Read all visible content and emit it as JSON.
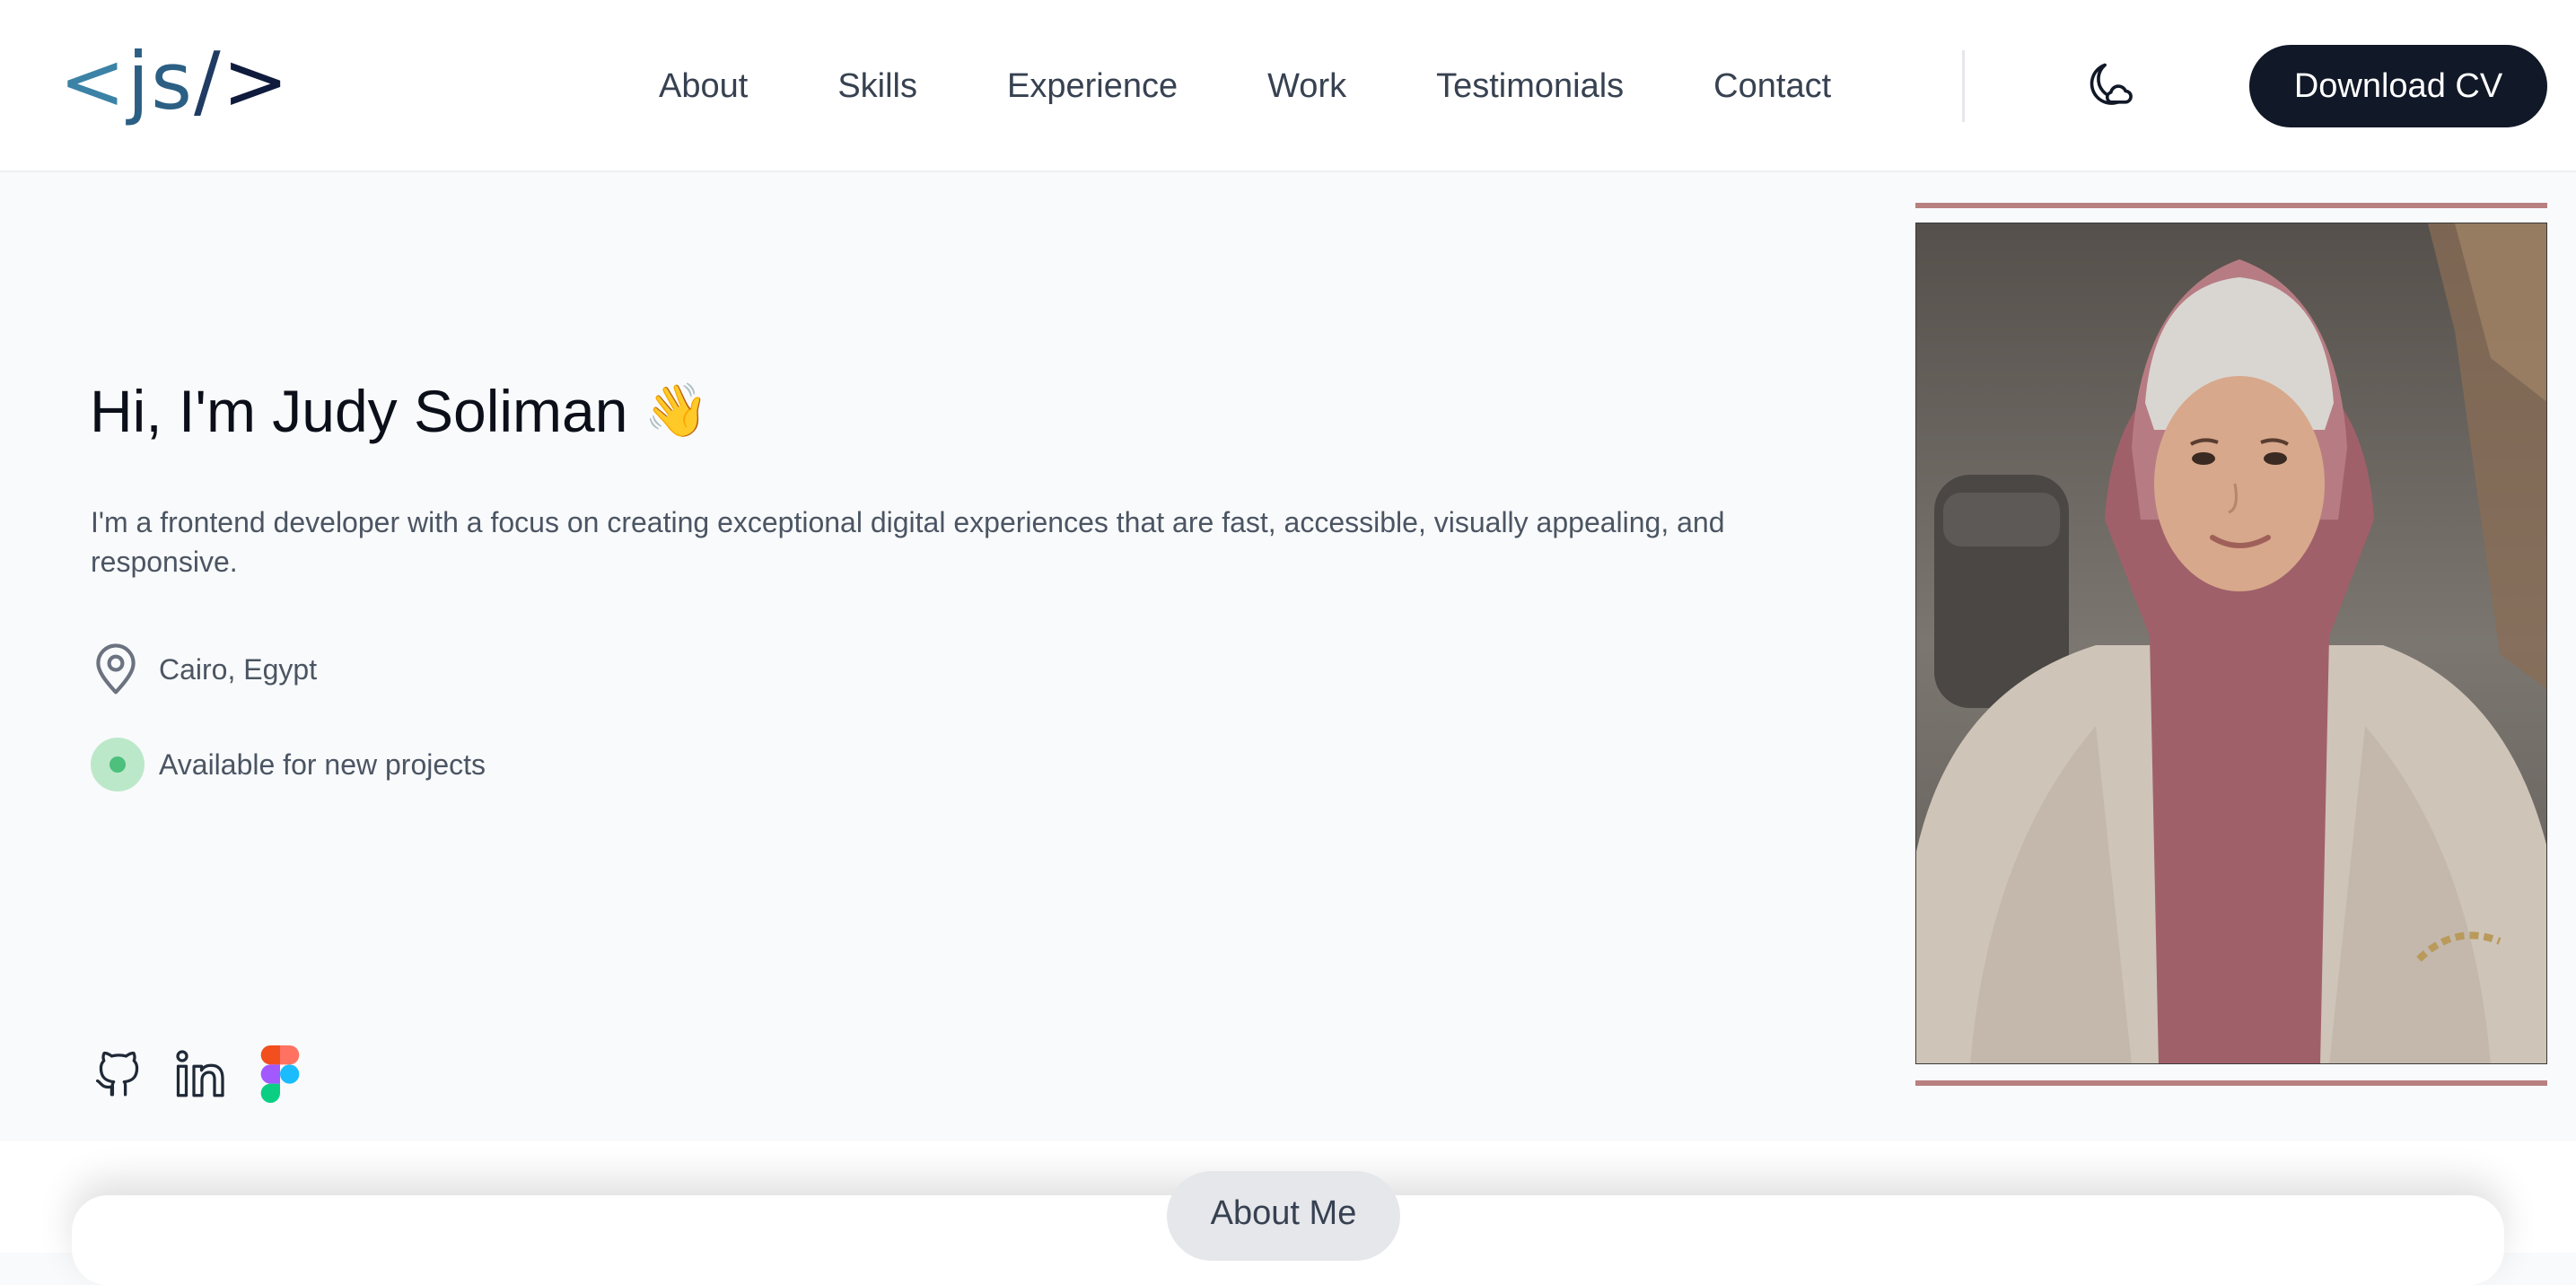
{
  "brand": {
    "logo_lt": "<",
    "logo_js": "js",
    "logo_slash": "/",
    "logo_gt": ">"
  },
  "nav": {
    "items": [
      {
        "label": "About"
      },
      {
        "label": "Skills"
      },
      {
        "label": "Experience"
      },
      {
        "label": "Work"
      },
      {
        "label": "Testimonials"
      },
      {
        "label": "Contact"
      }
    ],
    "theme_icon": "moon-icon",
    "cta_label": "Download CV"
  },
  "hero": {
    "greeting": "Hi, I'm Judy Soliman",
    "wave_emoji": "👋",
    "intro": "I'm a frontend developer with a focus on creating exceptional digital experiences that are fast, accessible, visually appealing, and responsive.",
    "location": "Cairo, Egypt",
    "location_icon": "map-pin-icon",
    "status": "Available for new projects",
    "status_color": "#4cc07c",
    "socials": [
      {
        "name": "github-icon"
      },
      {
        "name": "linkedin-icon"
      },
      {
        "name": "figma-icon"
      }
    ]
  },
  "photo": {
    "frame_color": "#b88080"
  },
  "section": {
    "about_pill": "About Me"
  },
  "colors": {
    "primary_button": "#111827",
    "background": "#f9fafb"
  }
}
